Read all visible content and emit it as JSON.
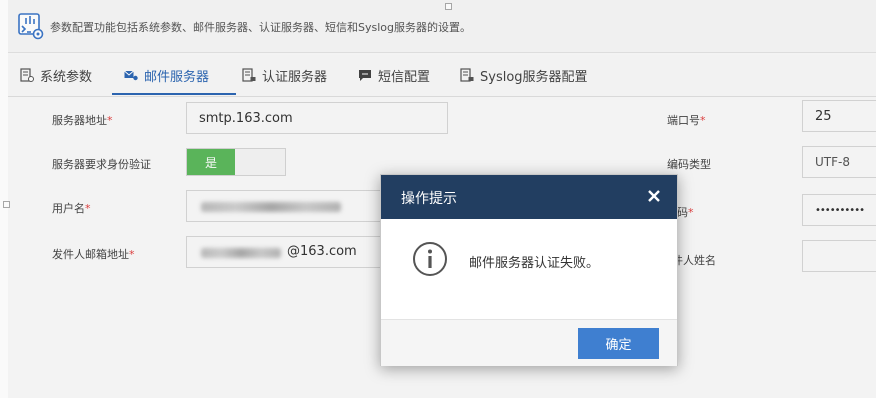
{
  "header": {
    "description": "参数配置功能包括系统参数、邮件服务器、认证服务器、短信和Syslog服务器的设置。",
    "icon": "config-settings-icon"
  },
  "tabs": [
    {
      "label": "系统参数",
      "icon": "system-params-icon",
      "active": false
    },
    {
      "label": "邮件服务器",
      "icon": "mail-server-icon",
      "active": true
    },
    {
      "label": "认证服务器",
      "icon": "auth-server-icon",
      "active": false
    },
    {
      "label": "短信配置",
      "icon": "sms-icon",
      "active": false
    },
    {
      "label": "Syslog服务器配置",
      "icon": "syslog-icon",
      "active": false
    }
  ],
  "form": {
    "server_address": {
      "label": "服务器地址",
      "required_mark": "*",
      "value": "smtp.163.com"
    },
    "auth_required": {
      "label": "服务器要求身份验证",
      "toggle_on_label": "是"
    },
    "username": {
      "label": "用户名",
      "required_mark": "*"
    },
    "sender_email": {
      "label": "发件人邮箱地址",
      "required_mark": "*",
      "value_suffix": "@163.com"
    },
    "port": {
      "label": "端口号",
      "required_mark": "*",
      "value": "25"
    },
    "encoding": {
      "label": "编码类型",
      "value": "UTF-8"
    },
    "password": {
      "label_visible": "码",
      "required_mark": "*",
      "value": "••••••••••"
    },
    "sender_name": {
      "label_visible": "件人姓名"
    }
  },
  "dialog": {
    "title": "操作提示",
    "message": "邮件服务器认证失败。",
    "ok_label": "确定",
    "close_icon": "close-icon",
    "info_icon": "info-icon"
  },
  "colors": {
    "accent": "#2d67b3",
    "dialog_header": "#223e61",
    "ok_button": "#3f7fd0",
    "toggle_on": "#5cb85c",
    "required": "#e04040"
  }
}
